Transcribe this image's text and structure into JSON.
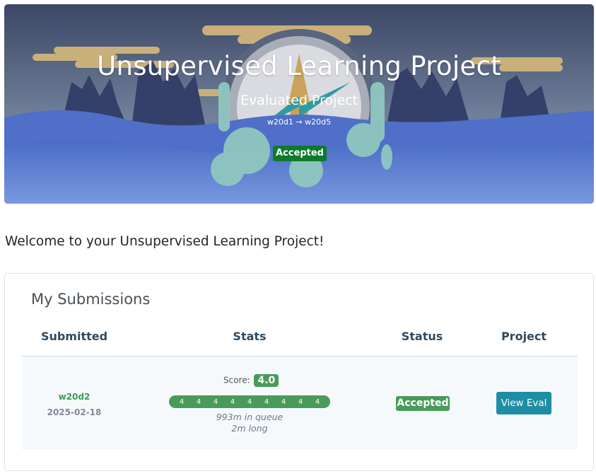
{
  "hero": {
    "title": "Unsupervised Learning Project",
    "subtitle": "Evaluated Project",
    "range": "w20d1 → w20d5",
    "status_badge": "Accepted",
    "colors": {
      "sky_top": "#3b4766",
      "sky_bottom": "#7d8fa6",
      "water": "#5b7fd1",
      "badge": "#0d7a2c"
    }
  },
  "welcome": "Welcome to your Unsupervised Learning Project!",
  "submissions": {
    "title": "My Submissions",
    "columns": [
      "Submitted",
      "Stats",
      "Status",
      "Project"
    ],
    "rows": [
      {
        "week": "w20d2",
        "date": "2025-02-18",
        "score_label": "Score:",
        "score": "4.0",
        "criteria": [
          "4",
          "4",
          "4",
          "4",
          "4",
          "4",
          "4",
          "4",
          "4"
        ],
        "queue": "993m in queue",
        "duration": "2m long",
        "status": "Accepted",
        "action": "View Eval"
      }
    ]
  },
  "colors": {
    "accent_green": "#4a9a5a",
    "button_teal": "#1d8ea3"
  }
}
